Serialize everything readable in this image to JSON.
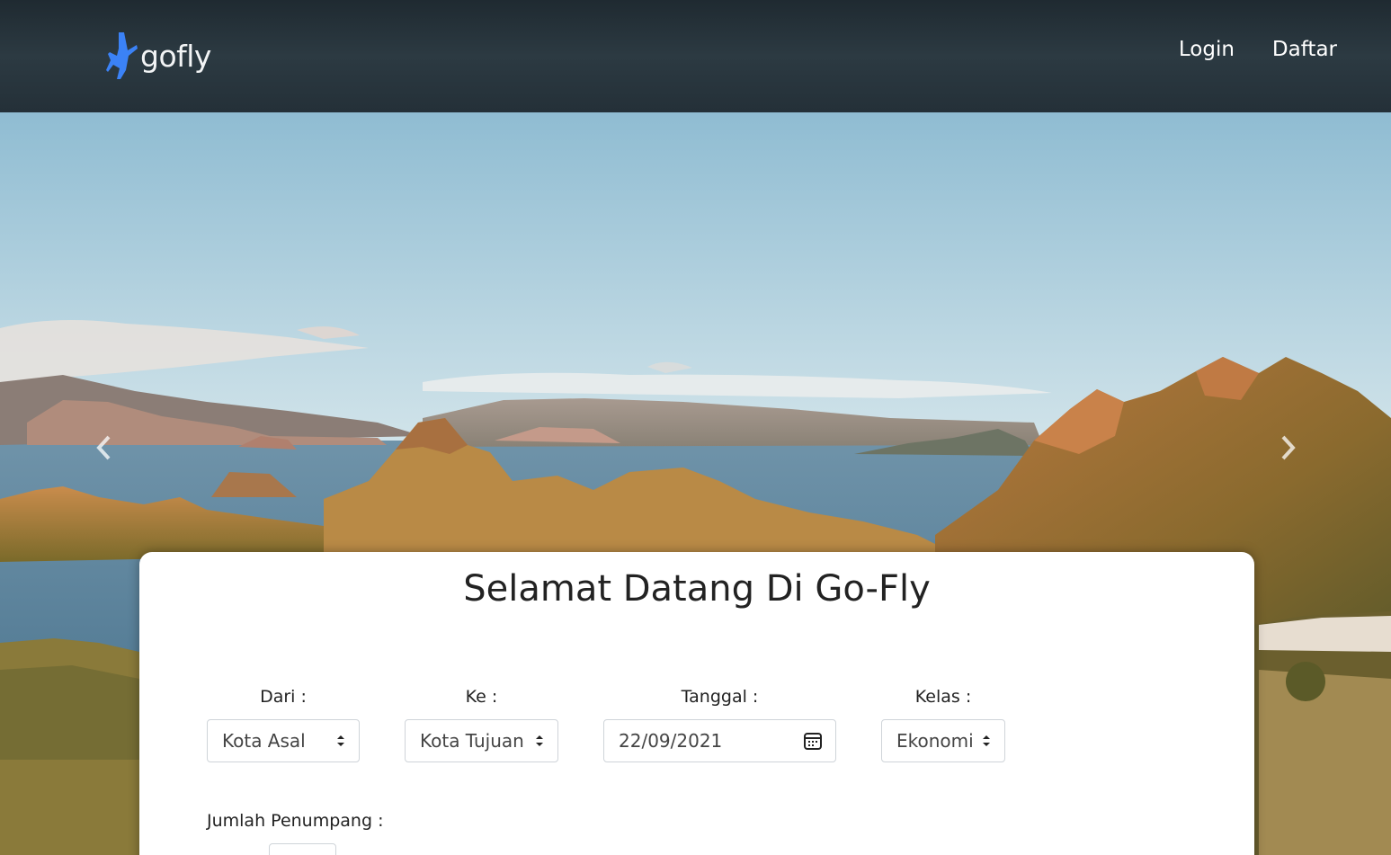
{
  "brand": {
    "name": "gofly",
    "icon": "airplane-icon",
    "color": "#3b82f6"
  },
  "nav": {
    "login": "Login",
    "register": "Daftar"
  },
  "carousel": {
    "prev_icon": "chevron-left-icon",
    "next_icon": "chevron-right-icon"
  },
  "form": {
    "title": "Selamat Datang Di Go-Fly",
    "dari": {
      "label": "Dari :",
      "value": "Kota Asal"
    },
    "ke": {
      "label": "Ke :",
      "value": "Kota Tujuan"
    },
    "tanggal": {
      "label": "Tanggal :",
      "value": "22/09/2021",
      "icon": "calendar-icon"
    },
    "kelas": {
      "label": "Kelas :",
      "value": "Ekonomi"
    },
    "jumlah": {
      "label": "Jumlah Penumpang :"
    }
  }
}
